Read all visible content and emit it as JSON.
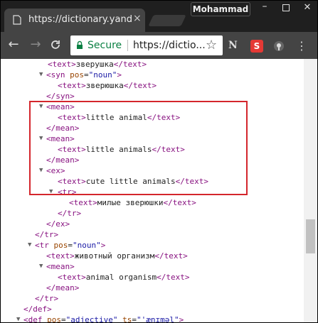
{
  "browser": {
    "tab": {
      "title": "https://dictionary.yandex",
      "close": "×"
    },
    "profile_name": "Mohammad",
    "window_controls": {
      "minimize": "–",
      "close": "✕"
    },
    "nav": {
      "back": "←",
      "forward": "→",
      "reload": "C"
    },
    "omnibox": {
      "secure_label": "Secure",
      "url": "https://dictio..."
    },
    "extensions": {
      "n": "N",
      "s": "S",
      "menu": "⋮"
    }
  },
  "xml_lines": [
    {
      "text": "<text>зверушка</text>"
    },
    {
      "text": "<syn pos=\"noun\">"
    },
    {
      "text": "<text>зверюшка</text>"
    },
    {
      "text": "</syn>"
    },
    {
      "text": "<mean>"
    },
    {
      "text": "<text>little animal</text>"
    },
    {
      "text": "</mean>"
    },
    {
      "text": "<mean>"
    },
    {
      "text": "<text>little animals</text>"
    },
    {
      "text": "</mean>"
    },
    {
      "text": "<ex>"
    },
    {
      "text": "<text>cute little animals</text>"
    },
    {
      "text": "<tr>"
    },
    {
      "text": "<text>милые зверюшки</text>"
    },
    {
      "text": "</tr>"
    },
    {
      "text": "</ex>"
    },
    {
      "text": "</tr>"
    },
    {
      "text": "<tr pos=\"noun\">"
    },
    {
      "text": "<text>животный организм</text>"
    },
    {
      "text": "<mean>"
    },
    {
      "text": "<text>animal organism</text>"
    },
    {
      "text": "</mean>"
    },
    {
      "text": "</tr>"
    },
    {
      "text": "</def>"
    },
    {
      "text": "<def pos=\"adjective\" ts=\"'ænɪməl\">"
    }
  ],
  "colors": {
    "highlight_border": "#d4262c",
    "secure_green": "#0b8043",
    "tag": "#881280"
  }
}
